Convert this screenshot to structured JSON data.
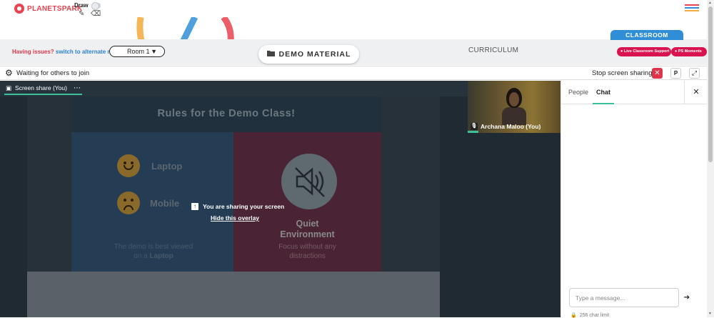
{
  "app": {
    "logo_text": "PLANETSPARK",
    "brand_color": "#e8434f"
  },
  "topbar": {
    "draw_label": "Draw",
    "draw_enabled": false,
    "pencil_icon": "pencil-icon",
    "eraser_icon": "eraser-icon",
    "menu_icon": "hamburger-menu-icon",
    "menu_colors": [
      "#e8434f",
      "#2f8ed6",
      "#f2a93b"
    ]
  },
  "classbar": {
    "issues_text": "Having issues?",
    "alt_room_link": "switch to alternate room",
    "room_selected": "Room 1",
    "demo_material_label": "DEMO MATERIAL",
    "curriculum_label": "CURRICULUM",
    "classroom_tab_label": "CLASSROOM",
    "live_support_label": "Live Classroom Support",
    "ps_moments_label": "PS Moments",
    "accent_red": "#d9134f",
    "accent_blue": "#2f8ed6"
  },
  "statusbar": {
    "waiting_text": "Waiting for others to join",
    "stop_sharing_label": "Stop screen sharing",
    "p_button_label": "P"
  },
  "stage": {
    "screen_share_tab": "Screen share (You)",
    "slide": {
      "title": "Rules for the Demo Class!",
      "laptop_label": "Laptop",
      "mobile_label": "Mobile",
      "note_line1": "The demo is best viewed",
      "note_line2_prefix": "on a ",
      "note_line2_bold": "Laptop",
      "quiet_line1": "Quiet",
      "quiet_line2": "Environment",
      "quiet_note_line1": "Focus without any",
      "quiet_note_line2": "distractions"
    },
    "overlay_message": "You are sharing your screen",
    "hide_overlay_link": "Hide this overlay",
    "participant_name": "Archana Maloo (You)",
    "speaking_color": "#3cc09b"
  },
  "panel": {
    "tab_people": "People",
    "tab_chat": "Chat",
    "active_tab": "Chat",
    "message_placeholder": "Type a message...",
    "char_limit": "256 char limit"
  }
}
